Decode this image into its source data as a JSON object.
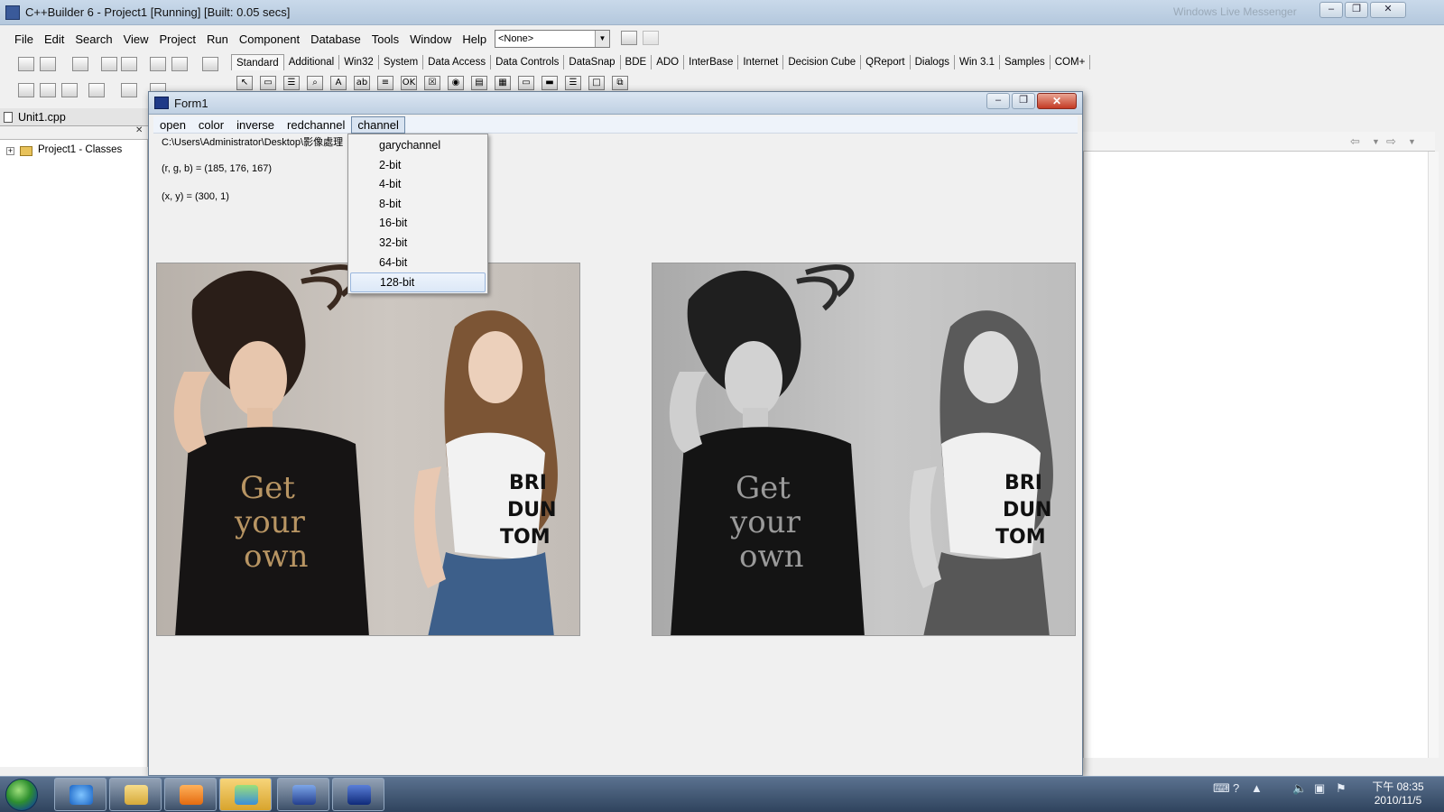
{
  "ide": {
    "title": "C++Builder 6 - Project1 [Running] [Built: 0.05 secs]",
    "ghost_title": "Windows Live Messenger",
    "menu": [
      "File",
      "Edit",
      "Search",
      "View",
      "Project",
      "Run",
      "Component",
      "Database",
      "Tools",
      "Window",
      "Help"
    ],
    "combo_value": "<None>",
    "palette_tabs": [
      "Standard",
      "Additional",
      "Win32",
      "System",
      "Data Access",
      "Data Controls",
      "DataSnap",
      "BDE",
      "ADO",
      "InterBase",
      "Internet",
      "Decision Cube",
      "QReport",
      "Dialogs",
      "Win 3.1",
      "Samples",
      "COM+"
    ],
    "palette_active": "Standard",
    "editor_tab": "Unit1.cpp",
    "tree_root": "Project1 - Classes",
    "palette_icons": [
      "↖",
      "▭",
      "☰",
      "⌕",
      "A",
      "ab",
      "≡",
      "OK",
      "☒",
      "◉",
      "▤",
      "▦",
      "▭",
      "▬",
      "☰",
      "□",
      "⧉"
    ]
  },
  "form": {
    "title": "Form1",
    "menu": [
      "open",
      "color",
      "inverse",
      "redchannel",
      "channel"
    ],
    "open_menu": "channel",
    "path": "C:\\Users\\Administrator\\Desktop\\影像處理",
    "rgb_readout": "(r, g, b) = (185, 176, 167)",
    "xy_readout": "(x, y) = (300, 1)",
    "channel_items": [
      "garychannel",
      "2-bit",
      "4-bit",
      "8-bit",
      "16-bit",
      "32-bit",
      "64-bit",
      "128-bit"
    ],
    "highlighted_item": "128-bit",
    "left_image": "color-photo-two-women",
    "right_image": "grayscale-photo-two-women"
  },
  "taskbar": {
    "clock_time": "下午 08:35",
    "clock_date": "2010/11/5",
    "apps": [
      "internet-explorer-icon",
      "explorer-folder-icon",
      "media-player-icon",
      "messenger-icon",
      "cpp-builder-icon",
      "form-app-icon"
    ]
  },
  "colors": {
    "titlebar": "#bfd0e2",
    "close_red": "#c43a24",
    "taskbar": "#2f435d",
    "highlight": "#dce8f7"
  }
}
